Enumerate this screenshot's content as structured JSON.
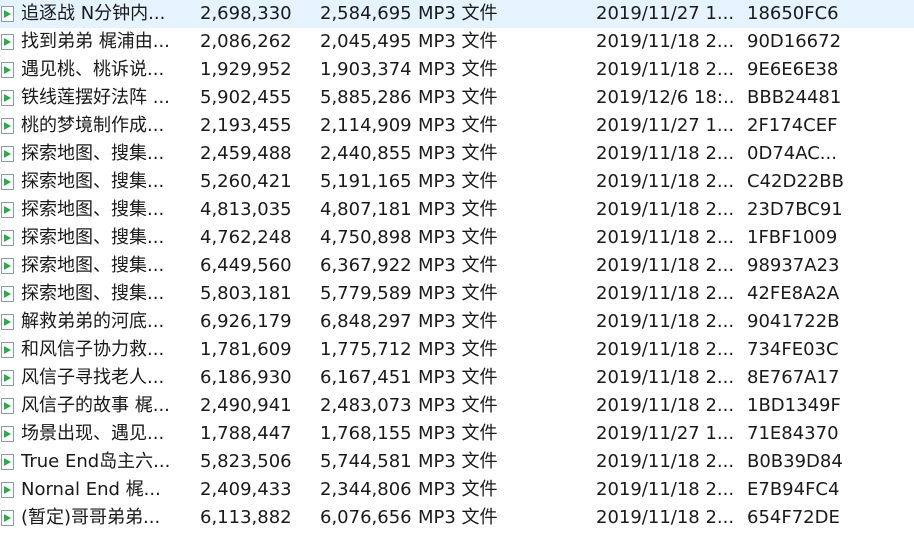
{
  "files": [
    {
      "name": "追逐战 N分钟内...",
      "size": "2,698,330",
      "packed": "2,584,695",
      "type": "MP3 文件",
      "modified": "2019/11/27 1...",
      "crc": "18650FC6"
    },
    {
      "name": "找到弟弟 梶浦由...",
      "size": "2,086,262",
      "packed": "2,045,495",
      "type": "MP3 文件",
      "modified": "2019/11/18 2...",
      "crc": "90D16672"
    },
    {
      "name": "遇见桃、桃诉说...",
      "size": "1,929,952",
      "packed": "1,903,374",
      "type": "MP3 文件",
      "modified": "2019/11/18 2...",
      "crc": "9E6E6E38"
    },
    {
      "name": "铁线莲摆好法阵 ...",
      "size": "5,902,455",
      "packed": "5,885,286",
      "type": "MP3 文件",
      "modified": "2019/12/6 18:...",
      "crc": "BBB24481"
    },
    {
      "name": "桃的梦境制作成...",
      "size": "2,193,455",
      "packed": "2,114,909",
      "type": "MP3 文件",
      "modified": "2019/11/27 1...",
      "crc": "2F174CEF"
    },
    {
      "name": "探索地图、搜集...",
      "size": "2,459,488",
      "packed": "2,440,855",
      "type": "MP3 文件",
      "modified": "2019/11/18 2...",
      "crc": "0D74AC..."
    },
    {
      "name": "探索地图、搜集...",
      "size": "5,260,421",
      "packed": "5,191,165",
      "type": "MP3 文件",
      "modified": "2019/11/18 2...",
      "crc": "C42D22BB"
    },
    {
      "name": "探索地图、搜集...",
      "size": "4,813,035",
      "packed": "4,807,181",
      "type": "MP3 文件",
      "modified": "2019/11/18 2...",
      "crc": "23D7BC91"
    },
    {
      "name": "探索地图、搜集...",
      "size": "4,762,248",
      "packed": "4,750,898",
      "type": "MP3 文件",
      "modified": "2019/11/18 2...",
      "crc": "1FBF1009"
    },
    {
      "name": "探索地图、搜集...",
      "size": "6,449,560",
      "packed": "6,367,922",
      "type": "MP3 文件",
      "modified": "2019/11/18 2...",
      "crc": "98937A23"
    },
    {
      "name": "探索地图、搜集...",
      "size": "5,803,181",
      "packed": "5,779,589",
      "type": "MP3 文件",
      "modified": "2019/11/18 2...",
      "crc": "42FE8A2A"
    },
    {
      "name": "解救弟弟的河底...",
      "size": "6,926,179",
      "packed": "6,848,297",
      "type": "MP3 文件",
      "modified": "2019/11/18 2...",
      "crc": "9041722B"
    },
    {
      "name": "和风信子协力救...",
      "size": "1,781,609",
      "packed": "1,775,712",
      "type": "MP3 文件",
      "modified": "2019/11/18 2...",
      "crc": "734FE03C"
    },
    {
      "name": "风信子寻找老人...",
      "size": "6,186,930",
      "packed": "6,167,451",
      "type": "MP3 文件",
      "modified": "2019/11/18 2...",
      "crc": "8E767A17"
    },
    {
      "name": "风信子的故事 梶...",
      "size": "2,490,941",
      "packed": "2,483,073",
      "type": "MP3 文件",
      "modified": "2019/11/18 2...",
      "crc": "1BD1349F"
    },
    {
      "name": "场景出现、遇见...",
      "size": "1,788,447",
      "packed": "1,768,155",
      "type": "MP3 文件",
      "modified": "2019/11/27 1...",
      "crc": "71E84370"
    },
    {
      "name": "True End岛主六...",
      "size": "5,823,506",
      "packed": "5,744,581",
      "type": "MP3 文件",
      "modified": "2019/11/18 2...",
      "crc": "B0B39D84"
    },
    {
      "name": "Nornal End 梶...",
      "size": "2,409,433",
      "packed": "2,344,806",
      "type": "MP3 文件",
      "modified": "2019/11/18 2...",
      "crc": "E7B94FC4"
    },
    {
      "name": "(暂定)哥哥弟弟...",
      "size": "6,113,882",
      "packed": "6,076,656",
      "type": "MP3 文件",
      "modified": "2019/11/18 2...",
      "crc": "654F72DE"
    }
  ],
  "icons": {
    "file": "audio-file-icon"
  },
  "colors": {
    "background": "#ffffff",
    "text": "#1a1a1a",
    "icon_accent": "#2fa84f"
  }
}
